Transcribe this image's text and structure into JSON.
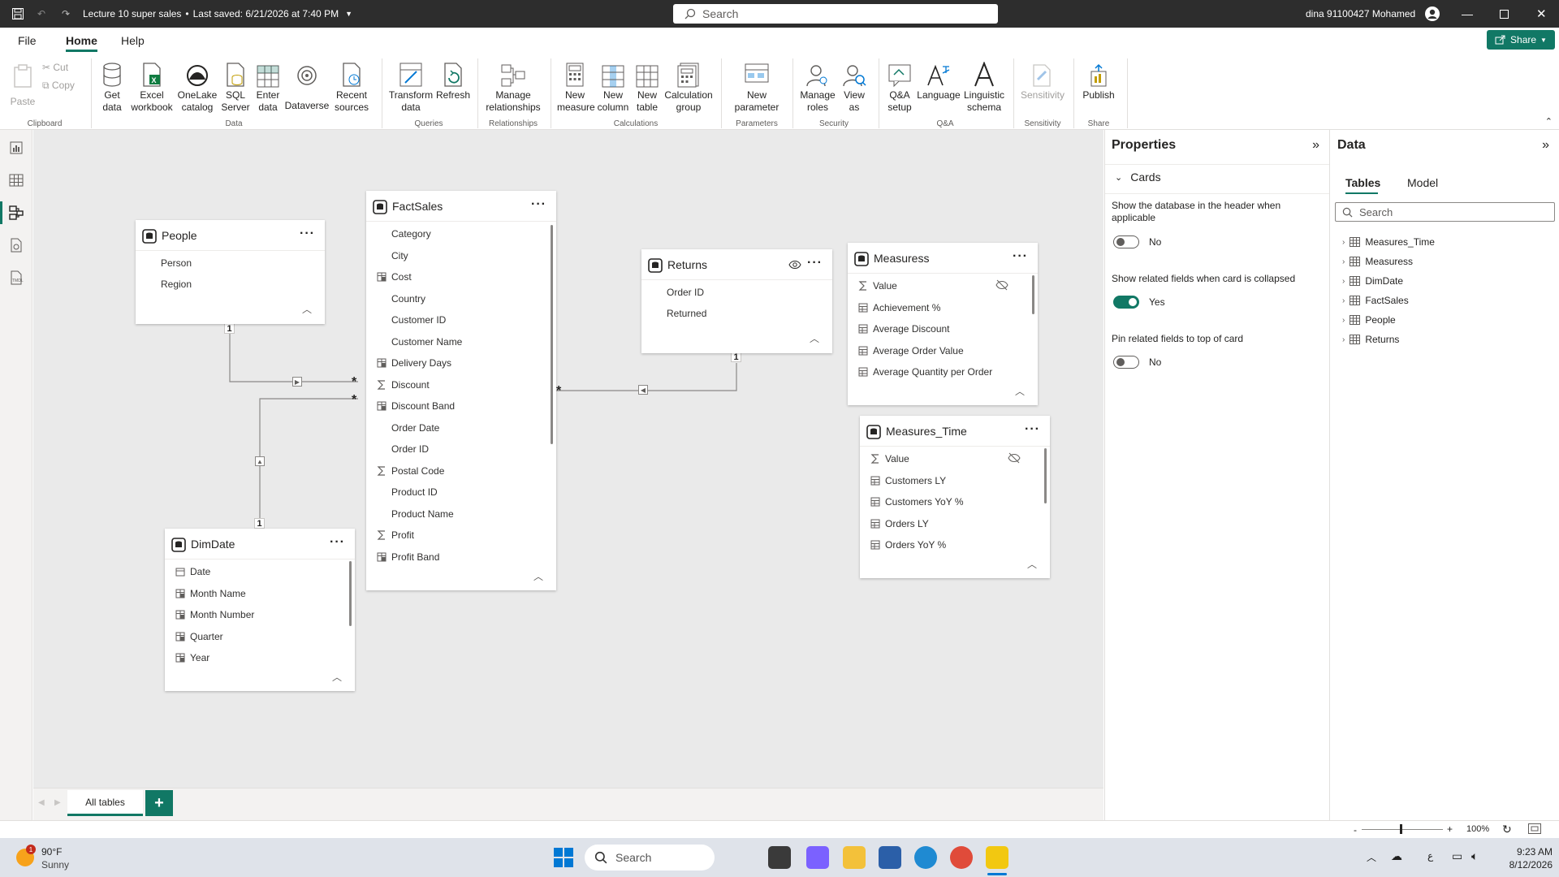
{
  "titlebar": {
    "file_title": "Lecture 10 super sales",
    "saved_status": "Last saved: 6/21/2026 at 7:40 PM",
    "search_placeholder": "Search",
    "user_name": "dina 91100427 Mohamed"
  },
  "menu": {
    "items": [
      "File",
      "Home",
      "Help"
    ],
    "active": "Home",
    "share_label": "Share"
  },
  "ribbon": {
    "clipboard": {
      "paste": "Paste",
      "cut": "Cut",
      "copy": "Copy",
      "group": "Clipboard"
    },
    "data": {
      "get_data": "Get data",
      "excel": "Excel workbook",
      "onelake": "OneLake catalog",
      "sql": "SQL Server",
      "enter": "Enter data",
      "dataverse": "Dataverse",
      "recent": "Recent sources",
      "group": "Data"
    },
    "queries": {
      "transform": "Transform data",
      "refresh": "Refresh",
      "group": "Queries"
    },
    "relationships": {
      "manage": "Manage relationships",
      "group": "Relationships"
    },
    "calculations": {
      "new_measure": "New measure",
      "new_column": "New column",
      "new_table": "New table",
      "calc_group": "Calculation group",
      "group": "Calculations"
    },
    "parameters": {
      "new_param": "New parameter",
      "group": "Parameters"
    },
    "security": {
      "manage_roles": "Manage roles",
      "view_as": "View as",
      "group": "Security"
    },
    "qa": {
      "setup": "Q&A setup",
      "language": "Language",
      "schema": "Linguistic schema",
      "group": "Q&A"
    },
    "sensitivity": {
      "label": "Sensitivity",
      "group": "Sensitivity"
    },
    "share": {
      "publish": "Publish",
      "group": "Share"
    }
  },
  "tables": {
    "people": {
      "name": "People",
      "fields": [
        "Person",
        "Region"
      ]
    },
    "factsales": {
      "name": "FactSales",
      "fields": [
        "Category",
        "City",
        "Cost",
        "Country",
        "Customer ID",
        "Customer Name",
        "Delivery Days",
        "Discount",
        "Discount Band",
        "Order Date",
        "Order ID",
        "Postal Code",
        "Product ID",
        "Product Name",
        "Profit",
        "Profit Band"
      ]
    },
    "returns": {
      "name": "Returns",
      "fields": [
        "Order ID",
        "Returned"
      ]
    },
    "measuress": {
      "name": "Measuress",
      "fields": [
        "Value",
        "Achievement %",
        "Average Discount",
        "Average Order Value",
        "Average Quantity per Order"
      ]
    },
    "measures_time": {
      "name": "Measures_Time",
      "fields": [
        "Value",
        "Customers LY",
        "Customers YoY %",
        "Orders LY",
        "Orders YoY %"
      ]
    },
    "dimdate": {
      "name": "DimDate",
      "fields": [
        "Date",
        "Month Name",
        "Month Number",
        "Quarter",
        "Year"
      ]
    }
  },
  "relationship_labels": {
    "one": "1",
    "many": "*"
  },
  "properties": {
    "title": "Properties",
    "section": "Cards",
    "opt1_label": "Show the database in the header when applicable",
    "opt1_value": "No",
    "opt2_label": "Show related fields when card is collapsed",
    "opt2_value": "Yes",
    "opt3_label": "Pin related fields to top of card",
    "opt3_value": "No"
  },
  "datapane": {
    "title": "Data",
    "tabs": [
      "Tables",
      "Model"
    ],
    "search_placeholder": "Search",
    "tree": [
      "Measures_Time",
      "Measuress",
      "DimDate",
      "FactSales",
      "People",
      "Returns"
    ]
  },
  "bottom": {
    "tab": "All tables",
    "add": "+"
  },
  "status": {
    "zoom": "100%"
  },
  "taskbar": {
    "temp": "90°F",
    "weather": "Sunny",
    "search": "Search",
    "time": "9:23 AM",
    "date": "8/12/2026"
  }
}
